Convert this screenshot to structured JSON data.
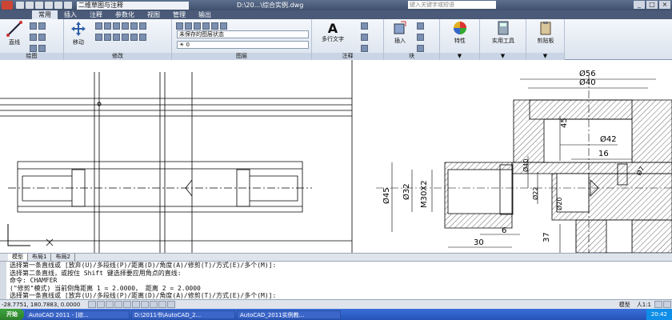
{
  "titlebar": {
    "workspace": "二维草图与注释",
    "document": "D:\\20...\\综合实例.dwg",
    "search_placeholder": "键入关键字或短语"
  },
  "tabs": [
    "常用",
    "插入",
    "注释",
    "参数化",
    "视图",
    "管理",
    "输出"
  ],
  "ribbon": {
    "draw_panel": "绘图",
    "line_label": "直线",
    "modify_panel": "修改",
    "move_label": "移动",
    "layers_panel": "图层",
    "layer_state": "未保存的图层状态",
    "layer_current": "0",
    "annotation_panel": "注释",
    "mtext_label": "多行文字",
    "block_panel": "块",
    "insert_label": "插入",
    "properties_label": "特性",
    "utilities_label": "实用工具",
    "clipboard_label": "剪贴板"
  },
  "drawing": {
    "dims": {
      "d56": "Ø56",
      "d40": "Ø40",
      "d42": "Ø42",
      "v45": "45",
      "v16": "16",
      "d32": "Ø32",
      "d45b": "Ø45",
      "m30": "M30X2",
      "v30": "30",
      "v6": "6",
      "v37": "37",
      "d22": "Ø22",
      "d20": "Ø20",
      "d7": "Ø7",
      "v40": "Ø40"
    }
  },
  "layout_tabs": [
    "模型",
    "布局1",
    "布局2"
  ],
  "command_lines": [
    "选择第一条直线或 [放弃(U)/多段线(P)/距离(D)/角度(A)/修剪(T)/方式(E)/多个(M)]:",
    "选择第二条直线，或按住 Shift 键选择要应用角点的直线:",
    "命令: CHAMFER",
    "(\"修剪\"模式) 当前倒角距离 1 = 2.0000， 距离 2 = 2.0000",
    "选择第一条直线或 [放弃(U)/多段线(P)/距离(D)/角度(A)/修剪(T)/方式(E)/多个(M)]:"
  ],
  "status": {
    "coords": "-28.7751, 180.7883, 0.0000",
    "model": "模型",
    "scale": "人1:1"
  },
  "taskbar": {
    "start": "开始",
    "items": [
      "AutoCAD 2011 - [综...",
      "D:\\2011书\\AutoCAD_2...",
      "AutoCAD_2011实例教..."
    ],
    "clock": "20:42"
  }
}
